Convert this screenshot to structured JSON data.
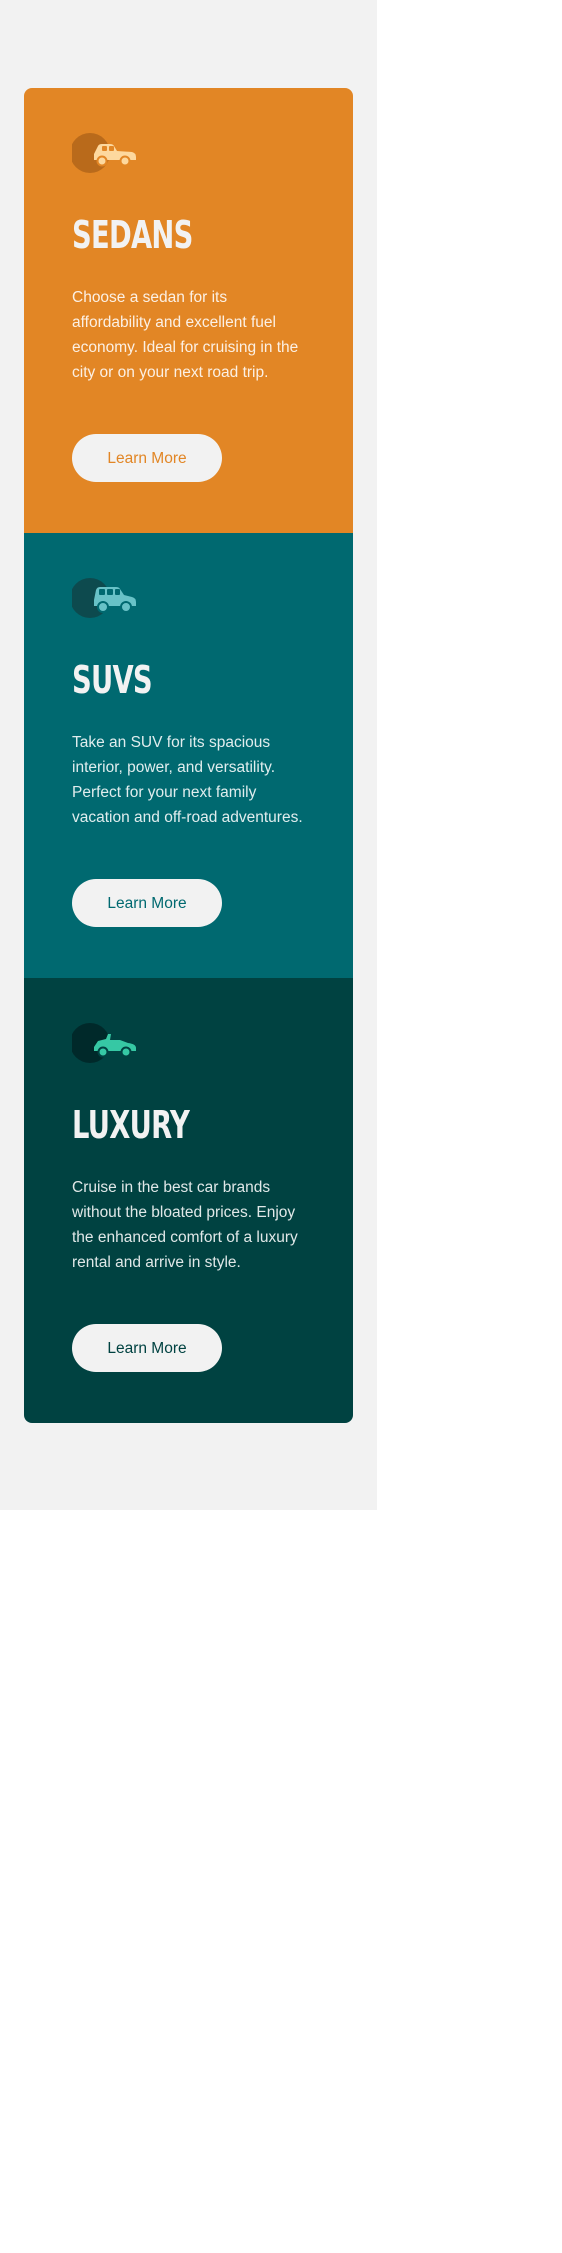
{
  "colors": {
    "page_background": "#f2f2f2",
    "sedans": "#e28625",
    "suvs": "#006970",
    "luxury": "#004241",
    "button_background": "#f2f2f2"
  },
  "cards": [
    {
      "icon": "sedan-car-icon",
      "title": "SEDANS",
      "text": "Choose a sedan for its affordability and excellent fuel economy. Ideal for cruising in the city or on your next road trip.",
      "button_label": "Learn More"
    },
    {
      "icon": "suv-car-icon",
      "title": "SUVS",
      "text": "Take an SUV for its spacious interior, power, and versatility. Perfect for your next family vacation and off-road adventures.",
      "button_label": "Learn More"
    },
    {
      "icon": "luxury-car-icon",
      "title": "LUXURY",
      "text": "Cruise in the best car brands without the bloated prices. Enjoy the enhanced comfort of a luxury rental and arrive in style.",
      "button_label": "Learn More"
    }
  ]
}
